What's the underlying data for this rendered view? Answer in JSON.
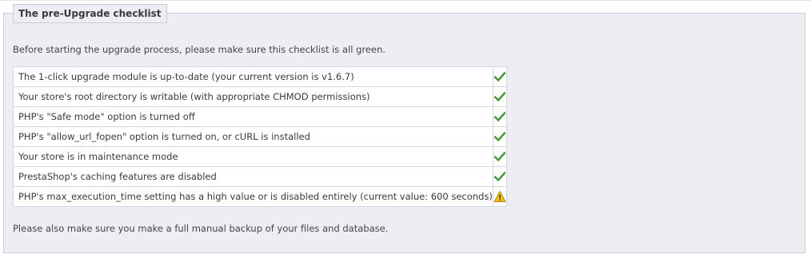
{
  "panel": {
    "title": "The pre-Upgrade checklist",
    "intro": "Before starting the upgrade process, please make sure this checklist is all green.",
    "footer_note": "Please also make sure you make a full manual backup of your files and database."
  },
  "checklist": [
    {
      "label": "The 1-click upgrade module is up-to-date (your current version is v1.6.7)",
      "status": "ok",
      "icon": "checkmark-icon"
    },
    {
      "label": "Your store's root directory is writable (with appropriate CHMOD permissions)",
      "status": "ok",
      "icon": "checkmark-icon"
    },
    {
      "label": "PHP's \"Safe mode\" option is turned off",
      "status": "ok",
      "icon": "checkmark-icon"
    },
    {
      "label": "PHP's \"allow_url_fopen\" option is turned on, or cURL is installed",
      "status": "ok",
      "icon": "checkmark-icon"
    },
    {
      "label": "Your store is in maintenance mode",
      "status": "ok",
      "icon": "checkmark-icon"
    },
    {
      "label": "PrestaShop's caching features are disabled",
      "status": "ok",
      "icon": "checkmark-icon"
    },
    {
      "label": "PHP's max_execution_time setting has a high value or is disabled entirely (current value: 600 seconds)",
      "status": "warning",
      "icon": "warning-icon"
    }
  ],
  "colors": {
    "ok": "#4a9a3a",
    "warning": "#f0c419",
    "panel_bg": "#eceef4",
    "border": "#c8ccd6"
  }
}
